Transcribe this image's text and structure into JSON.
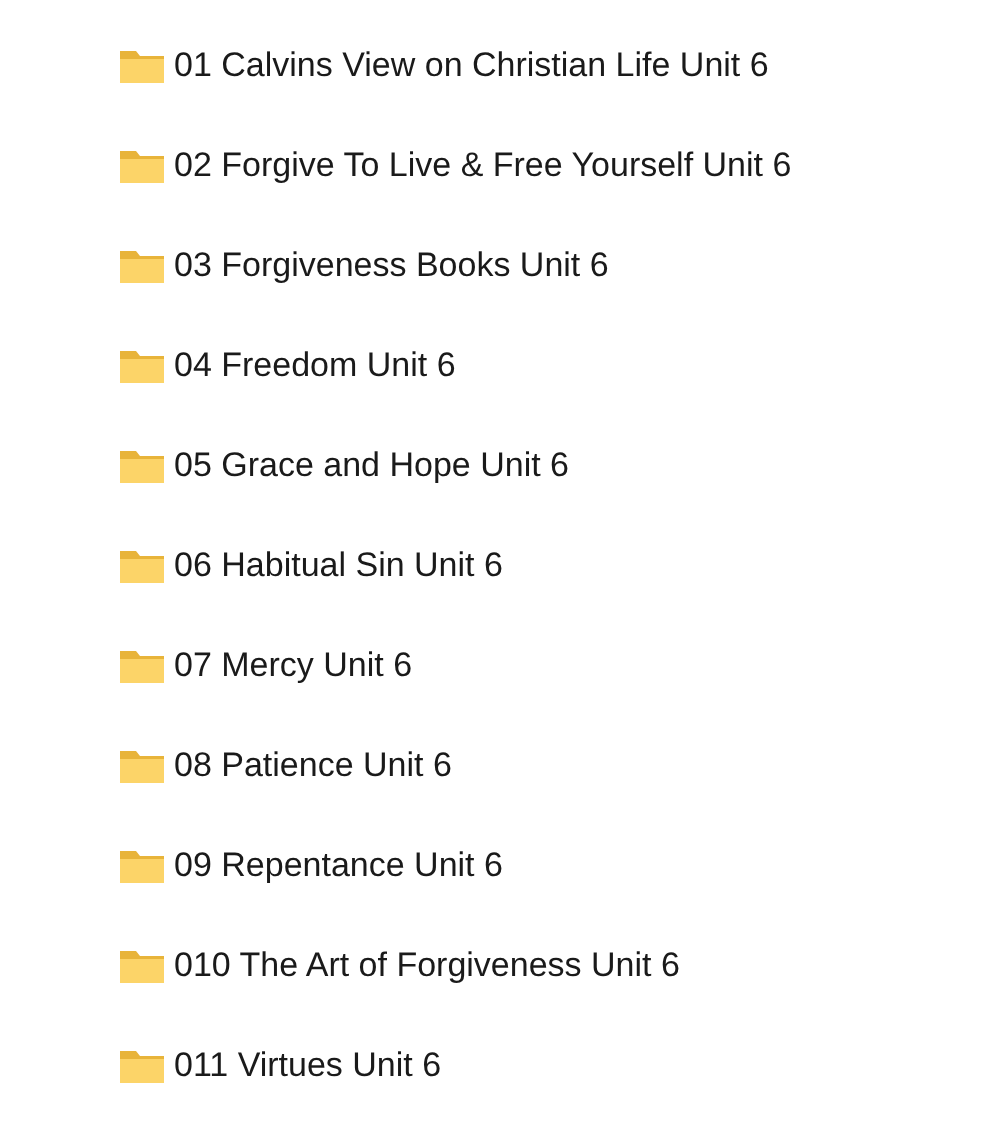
{
  "folders": [
    {
      "name": "01 Calvins View on Christian Life Unit 6"
    },
    {
      "name": "02 Forgive To Live & Free Yourself Unit 6"
    },
    {
      "name": "03 Forgiveness Books Unit 6"
    },
    {
      "name": "04 Freedom Unit 6"
    },
    {
      "name": "05 Grace and Hope Unit 6"
    },
    {
      "name": "06 Habitual Sin Unit 6"
    },
    {
      "name": "07 Mercy Unit 6"
    },
    {
      "name": "08 Patience Unit 6"
    },
    {
      "name": "09 Repentance Unit 6"
    },
    {
      "name": "010 The Art of Forgiveness Unit 6"
    },
    {
      "name": "011 Virtues Unit 6"
    }
  ]
}
